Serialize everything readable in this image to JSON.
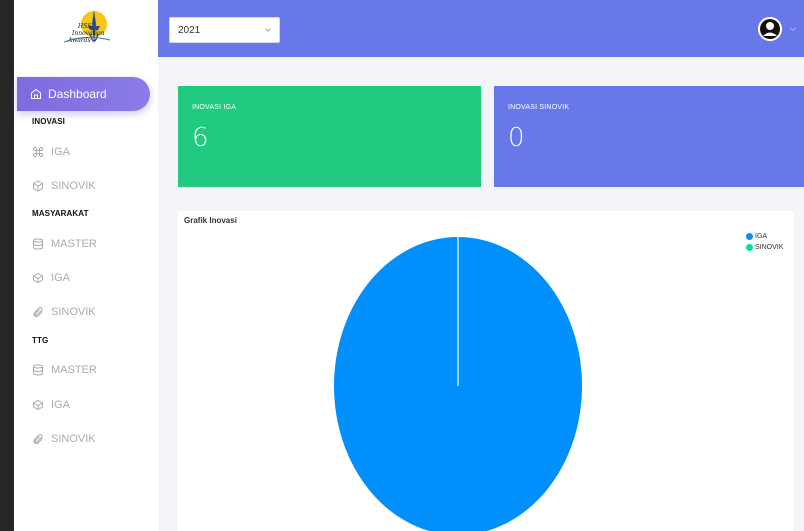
{
  "sidebar": {
    "logo": {
      "line1": "HSS",
      "line2": "Innovation",
      "line3": "Awards"
    },
    "active_item": {
      "label": "Dashboard",
      "icon": "home-icon"
    },
    "sections": [
      {
        "title": "INOVASI",
        "items": [
          {
            "label": "IGA",
            "icon": "command-icon"
          },
          {
            "label": "SINOVIK",
            "icon": "hexagon-box-icon"
          }
        ]
      },
      {
        "title": "MASYARAKAT",
        "items": [
          {
            "label": "MASTER",
            "icon": "database-icon"
          },
          {
            "label": "IGA",
            "icon": "box-icon"
          },
          {
            "label": "SINOVIK",
            "icon": "paperclip-icon"
          }
        ]
      },
      {
        "title": "TTG",
        "items": [
          {
            "label": "MASTER",
            "icon": "database-icon"
          },
          {
            "label": "IGA",
            "icon": "box-icon"
          },
          {
            "label": "SINOVIK",
            "icon": "paperclip-icon"
          }
        ]
      }
    ]
  },
  "topbar": {
    "year_select": {
      "value": "2021"
    },
    "avatar_icon": "user-avatar-icon",
    "caret_icon": "chevron-down-icon"
  },
  "cards": [
    {
      "label": "INOVASI IGA",
      "value": "6",
      "color": "#22c981"
    },
    {
      "label": "INOVASI SINOVIK",
      "value": "0",
      "color": "#6978e8"
    }
  ],
  "chart": {
    "title": "Grafik Inovasi"
  },
  "chart_data": {
    "type": "pie",
    "title": "Grafik Inovasi",
    "categories": [
      "IGA",
      "SINOVIK"
    ],
    "values": [
      6,
      0
    ],
    "colors": [
      "#008ffb",
      "#00e396"
    ],
    "legend_position": "top-right"
  }
}
